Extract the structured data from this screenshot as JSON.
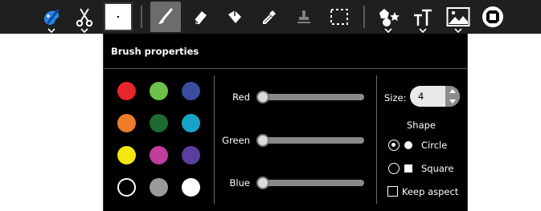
{
  "toolbar": {
    "tools": [
      {
        "icon": "paint-palette-icon"
      },
      {
        "icon": "scissors-icon"
      },
      {
        "icon": "color-swatch-icon"
      },
      {
        "icon": "paintbrush-icon",
        "selected": true
      },
      {
        "icon": "eraser-icon"
      },
      {
        "icon": "fill-bucket-icon"
      },
      {
        "icon": "color-picker-icon"
      },
      {
        "icon": "stamp-icon"
      },
      {
        "icon": "rectangle-select-icon"
      },
      {
        "icon": "shapes-icon"
      },
      {
        "icon": "text-icon"
      },
      {
        "icon": "insert-image-icon"
      },
      {
        "icon": "stop-icon"
      }
    ]
  },
  "brush_panel": {
    "title": "Brush properties",
    "palette": [
      "#e8262b",
      "#6cc24a",
      "#3a4ba0",
      "#ee7d2a",
      "#1d6b33",
      "#18a3c8",
      "#f5e60e",
      "#c03f9e",
      "#5a3f9e",
      "#000000",
      "#9a9a9a",
      "#ffffff"
    ],
    "sliders": [
      {
        "label": "Red",
        "value": 0
      },
      {
        "label": "Green",
        "value": 0
      },
      {
        "label": "Blue",
        "value": 0
      }
    ],
    "size_label": "Size:",
    "size_value": "4",
    "shape_title": "Shape",
    "shape_options": [
      {
        "label": "Circle",
        "selected": true
      },
      {
        "label": "Square",
        "selected": false
      }
    ],
    "keep_aspect_label": "Keep aspect",
    "keep_aspect_checked": false
  }
}
